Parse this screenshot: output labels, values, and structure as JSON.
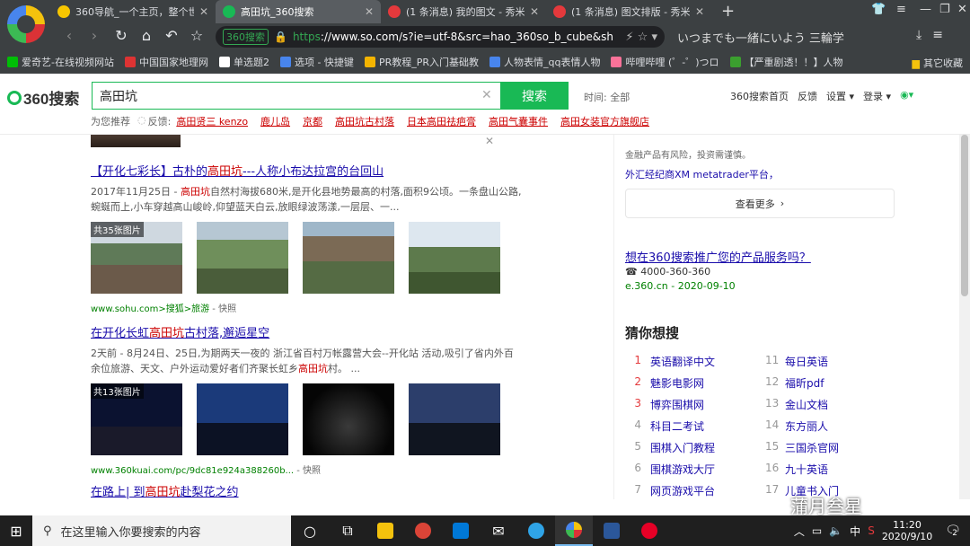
{
  "tabs": [
    {
      "title": "360导航_一个主页，整个世界",
      "color": "#f7c600",
      "active": false
    },
    {
      "title": "高田坑_360搜索",
      "color": "#19b955",
      "active": true
    },
    {
      "title": "(1 条消息) 我的图文 - 秀米 X",
      "color": "#e4393c",
      "active": false
    },
    {
      "title": "(1 条消息) 图文排版 - 秀米 X",
      "color": "#e4393c",
      "active": false
    }
  ],
  "toolbar": {
    "secure_label": "360搜索",
    "url_proto": "https",
    "url_rest": "://www.so.com/s?ie=utf-8&src=hao_360so_b_cube&sh",
    "marquee": "いつまでも一緒にいよう 三輪学"
  },
  "bookmarks": [
    {
      "label": "爱奇艺-在线视频网站",
      "color": "#00be06"
    },
    {
      "label": "中国国家地理网",
      "color": "#d33"
    },
    {
      "label": "单选题2",
      "color": "#fff"
    },
    {
      "label": "选项 - 快捷键",
      "color": "#4885ed"
    },
    {
      "label": "PR教程_PR入门基础教",
      "color": "#f4b400"
    },
    {
      "label": "人物表情_qq表情人物",
      "color": "#4885ed"
    },
    {
      "label": "哔哩哔哩 (゜-゜)つロ",
      "color": "#fb7299"
    },
    {
      "label": "【严重剧透！！】人物",
      "color": "#3b9f2f"
    }
  ],
  "bookmarks_other": "其它收藏",
  "search": {
    "logo_text": "360搜索",
    "query": "高田坑",
    "button": "搜索",
    "time_filter": "时间: 全部",
    "header_links": [
      "360搜索首页",
      "反馈",
      "设置 ▾",
      "登录 ▾"
    ]
  },
  "related": {
    "prefix": "为您推荐",
    "feedback": "反馈:",
    "links": [
      "高田贤三 kenzo",
      "鹿儿岛",
      "京都",
      "高田坑古村落",
      "日本高田祛疤膏",
      "高田气囊事件",
      "高田女装官方旗舰店"
    ]
  },
  "results": [
    {
      "title_pre": "【开化七彩长】古朴的",
      "title_em": "高田坑",
      "title_post": "---人称小布达拉宫的台回山",
      "desc_pre": "2017年11月25日 - ",
      "desc_em": "高田坑",
      "desc_post": "自然村海拔680米,是开化县地势最高的村落,面积9公顷。一条盘山公路,蜿蜒而上,小车穿越高山峻岭,仰望蓝天白云,放眼绿波荡漾,一层层、一...",
      "thumb_count": "共35张图片",
      "url": "www.sohu.com>搜狐>旅游",
      "snap": " - 快照"
    },
    {
      "title_pre": "在开化长虹",
      "title_em": "高田坑",
      "title_post": "古村落,邂逅星空",
      "desc_pre": "2天前 - 8月24日、25日,为期两天一夜的 浙江省百村万帐露营大会--开化站 活动,吸引了省内外百余位旅游、天文、户外运动爱好者们齐聚长虹乡",
      "desc_em": "高田坑",
      "desc_post": "村。 ...",
      "thumb_count": "共13张图片",
      "url": "www.360kuai.com/pc/9dc81e924a388260b...",
      "snap": " - 快照"
    },
    {
      "title_pre": "在路上| 到",
      "title_em": "高田坑",
      "title_post": "赴梨花之约"
    }
  ],
  "right": {
    "ad_note": "金融产品有风险，投资需谨慎。",
    "ad_cut": "外汇经纪商XM metatrader平台，",
    "see_more": "查看更多",
    "promo_title": "想在360搜索推广您的产品服务吗？",
    "promo_phone": "☎ 4000-360-360",
    "promo_url": "e.360.cn - 2020-09-10",
    "guess_title": "猜你想搜",
    "guess": [
      {
        "n": "1",
        "t": "英语翻译中文"
      },
      {
        "n": "11",
        "t": "每日英语"
      },
      {
        "n": "2",
        "t": "魅影电影网"
      },
      {
        "n": "12",
        "t": "福昕pdf"
      },
      {
        "n": "3",
        "t": "博弈围棋网"
      },
      {
        "n": "13",
        "t": "金山文档"
      },
      {
        "n": "4",
        "t": "科目二考试"
      },
      {
        "n": "14",
        "t": "东方丽人"
      },
      {
        "n": "5",
        "t": "围棋入门教程"
      },
      {
        "n": "15",
        "t": "三国杀官网"
      },
      {
        "n": "6",
        "t": "围棋游戏大厅"
      },
      {
        "n": "16",
        "t": "九十英语"
      },
      {
        "n": "7",
        "t": "网页游戏平台"
      },
      {
        "n": "17",
        "t": "儿童书入门"
      }
    ]
  },
  "watermark": "蒲月叁星",
  "taskbar": {
    "search_placeholder": "在这里输入你要搜索的内容",
    "ime": "中",
    "time": "11:20",
    "date": "2020/9/10",
    "notif_count": "2"
  }
}
